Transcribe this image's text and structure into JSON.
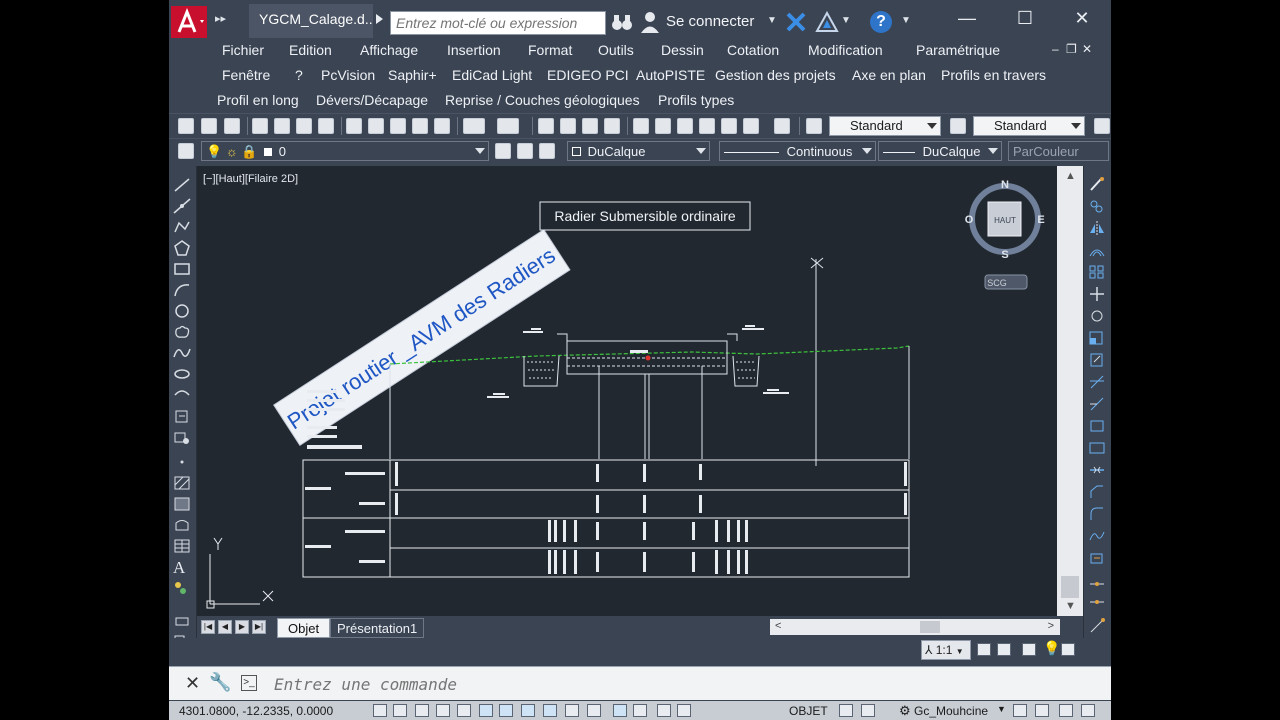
{
  "titlebar": {
    "doc_name": "YGCM_Calage.d...",
    "search_placeholder": "Entrez mot-clé ou expression",
    "signin": "Se connecter"
  },
  "menus": {
    "row1": [
      "Fichier",
      "Edition",
      "Affichage",
      "Insertion",
      "Format",
      "Outils",
      "Dessin",
      "Cotation",
      "Modification",
      "Paramétrique"
    ],
    "row2": [
      "Fenêtre",
      "?",
      "PcVision",
      "Saphir+",
      "EdiCad Light",
      "EDIGEO PCI",
      "AutoPISTE",
      "Gestion des projets",
      "Axe en plan",
      "Profils en travers"
    ],
    "row3": [
      "Profil en long",
      "Dévers/Décapage",
      "Reprise / Couches géologiques",
      "Profils types"
    ]
  },
  "toolbar": {
    "text_style": "Standard",
    "dim_style": "Standard",
    "layer": "0",
    "color": "DuCalque",
    "linetype": "Continuous",
    "lineweight": "DuCalque",
    "plotstyle": "ParCouleur"
  },
  "viewport": {
    "label": "[−][Haut][Filaire 2D]",
    "drawing_title": "Radier Submersible ordinaire",
    "watermark": "Projet routier _AVM des Radiers",
    "viewcube": {
      "top": "HAUT",
      "n": "N",
      "s": "S",
      "e": "E",
      "w": "O",
      "ucs": "SCG"
    },
    "axis_x": "X",
    "axis_y": "Y"
  },
  "tabs": {
    "model": "Objet",
    "layout": "Présentation1"
  },
  "scale": "1:1",
  "command": {
    "placeholder": "Entrez une commande"
  },
  "status": {
    "coords": "4301.0800, -12.2335, 0.0000",
    "mode": "OBJET",
    "workspace": "Gc_Mouhcine"
  },
  "colors": {
    "ui_dark": "#3b4453",
    "canvas": "#212830",
    "terrain_line": "#3cc23c"
  }
}
